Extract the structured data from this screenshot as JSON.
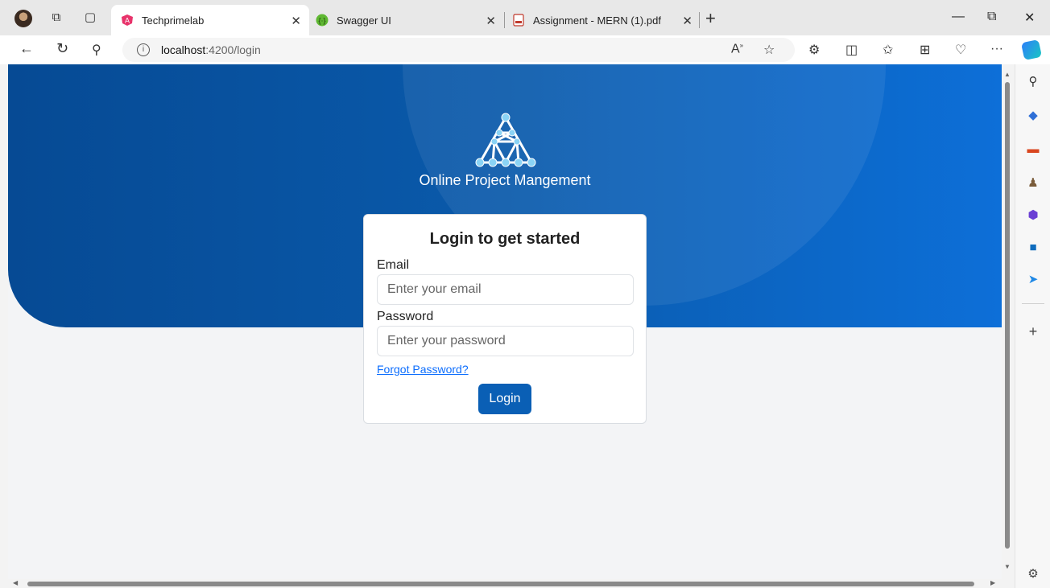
{
  "browser": {
    "tabs": [
      {
        "title": "Techprimelab",
        "active": true
      },
      {
        "title": "Swagger UI",
        "active": false
      },
      {
        "title": "Assignment - MERN (1).pdf",
        "active": false
      }
    ],
    "address": {
      "host": "localhost",
      "path": ":4200/login"
    }
  },
  "hero": {
    "app_name": "Online Project Mangement"
  },
  "login": {
    "heading": "Login to get started",
    "email_label": "Email",
    "email_placeholder": "Enter your email",
    "password_label": "Password",
    "password_placeholder": "Enter your password",
    "forgot_link": "Forgot Password?",
    "submit_label": "Login"
  },
  "colors": {
    "hero_dark": "#064a94",
    "hero_light": "#0d6fd8",
    "button": "#0a5fb5",
    "link": "#0d6efd"
  }
}
